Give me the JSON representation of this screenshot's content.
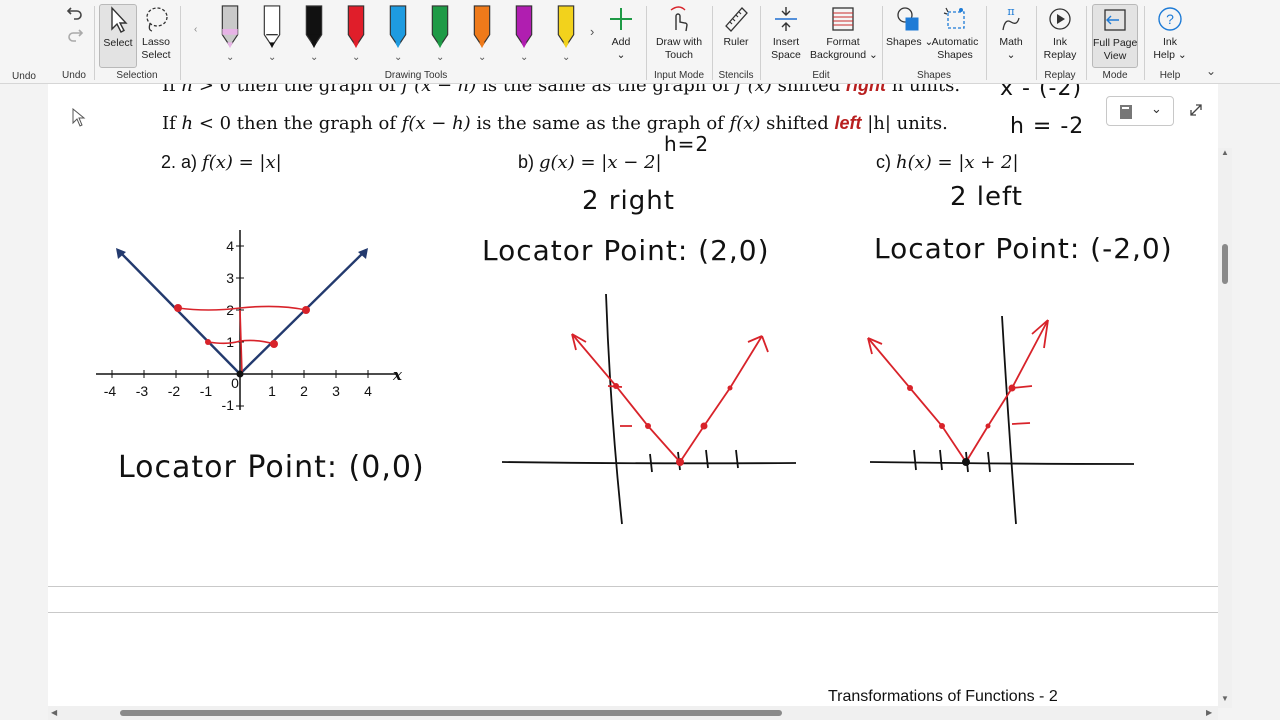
{
  "ribbon": {
    "undo": {
      "label": "Undo",
      "group": "Undo"
    },
    "selection": {
      "select": "Select",
      "lasso1": "Lasso",
      "lasso2": "Select",
      "group": "Selection"
    },
    "drawing_tools": {
      "group": "Drawing Tools",
      "add": "Add",
      "pens": [
        {
          "name": "eraser-tool",
          "color": "#c9c9c9",
          "tip": "#e7b3e6"
        },
        {
          "name": "pen-black-fine",
          "color": "#ffffff",
          "tip": "#111111"
        },
        {
          "name": "pen-black",
          "color": "#111111",
          "tip": "#111111"
        },
        {
          "name": "pen-red",
          "color": "#e01e2a",
          "tip": "#e01e2a"
        },
        {
          "name": "pen-blue",
          "color": "#1e9be0",
          "tip": "#1e9be0"
        },
        {
          "name": "pen-green",
          "color": "#1e9a46",
          "tip": "#1e9a46"
        },
        {
          "name": "pen-orange",
          "color": "#ef7a1a",
          "tip": "#ef7a1a"
        },
        {
          "name": "pen-purple",
          "color": "#b01eb0",
          "tip": "#b01eb0"
        },
        {
          "name": "highlighter-yellow",
          "color": "#f2d21c",
          "tip": "#f2d21c"
        }
      ]
    },
    "input_mode": {
      "label1": "Draw with",
      "label2": "Touch",
      "group": "Input Mode"
    },
    "stencils": {
      "label": "Ruler",
      "group": "Stencils"
    },
    "edit": {
      "insert1": "Insert",
      "insert2": "Space",
      "format1": "Format",
      "format2": "Background",
      "group": "Edit"
    },
    "shapes": {
      "shapes": "Shapes",
      "auto1": "Automatic",
      "auto2": "Shapes",
      "group": "Shapes"
    },
    "math": {
      "label": "Math"
    },
    "replay": {
      "label1": "Ink",
      "label2": "Replay",
      "group": "Replay"
    },
    "mode": {
      "label1": "Full Page",
      "label2": "View",
      "group": "Mode"
    },
    "help": {
      "label1": "Ink",
      "label2": "Help",
      "group": "Help"
    }
  },
  "document": {
    "rule1": {
      "prefix": "If ",
      "h": "h",
      "cond": " > 0  then the graph of ",
      "fx": "f (x − h)",
      "mid": " is the same as the graph of ",
      "f2": "f (x)",
      "shift": " shifted ",
      "dir": "right",
      "end": " h units."
    },
    "rule2": {
      "prefix": "If ",
      "h": "h",
      "cond": " < 0  then the graph of ",
      "fx": "f(x − h)",
      "mid": " is the same as the graph of ",
      "f2": "f(x)",
      "shift": " shifted ",
      "dir": "left",
      "end": " |h| units."
    },
    "problem_a": {
      "label": "2. a) ",
      "f": "f(x) = |x|"
    },
    "problem_b": {
      "label": "b) ",
      "f": "g(x) = |x − 2|"
    },
    "problem_c": {
      "label": "c) ",
      "f": "h(x) = |x + 2|"
    },
    "footer": "Transformations of Functions - 2",
    "handwriting": {
      "h_eq_2": "h=2",
      "h_eq_neg2": "h = -2",
      "x_minus_neg2": "x - (-2)",
      "two_right": "2  right",
      "two_left": "2  left",
      "loc_a": "Locator Point: (0,0)",
      "loc_b": "Locator Point:  (2,0)",
      "loc_c": "Locator Point: (-2,0)"
    },
    "graph_a": {
      "x_ticks": [
        "-4",
        "-3",
        "-2",
        "-1",
        "0",
        "1",
        "2",
        "3",
        "4"
      ],
      "y_ticks": [
        "4",
        "3",
        "2",
        "1",
        "-1"
      ],
      "x_axis_label": "x"
    }
  },
  "colors": {
    "ink_red": "#d8232a",
    "graph_blue": "#233a6e",
    "emphasis_red": "#b81f1f"
  }
}
